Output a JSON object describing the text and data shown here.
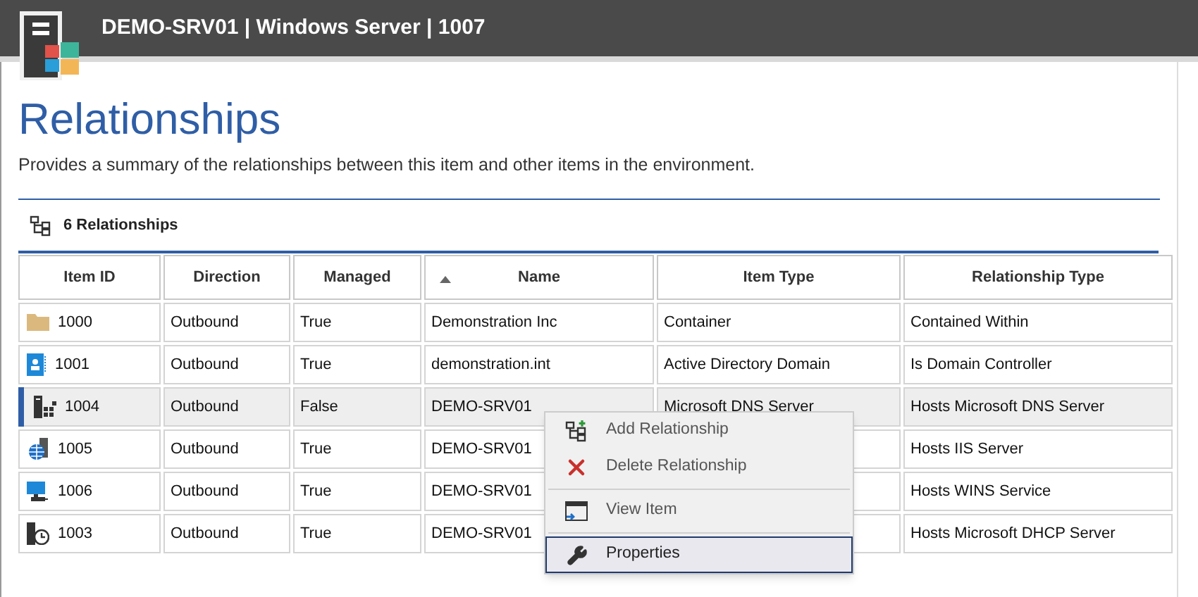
{
  "header": {
    "title": "DEMO-SRV01 | Windows Server | 1007"
  },
  "page": {
    "title": "Relationships",
    "description": "Provides a summary of the relationships between this item and other items in the environment."
  },
  "toolbar": {
    "count_label": "6 Relationships"
  },
  "table": {
    "columns": [
      {
        "label": "Item ID",
        "sorted": false
      },
      {
        "label": "Direction",
        "sorted": false
      },
      {
        "label": "Managed",
        "sorted": false
      },
      {
        "label": "Name",
        "sorted": true
      },
      {
        "label": "Item Type",
        "sorted": false
      },
      {
        "label": "Relationship Type",
        "sorted": false
      }
    ],
    "rows": [
      {
        "kind": "folder",
        "item_id": "1000",
        "direction": "Outbound",
        "managed": "True",
        "name": "Demonstration Inc",
        "item_type": "Container",
        "relationship_type": "Contained Within",
        "selected": false
      },
      {
        "kind": "domain",
        "item_id": "1001",
        "direction": "Outbound",
        "managed": "True",
        "name": "demonstration.int",
        "item_type": "Active Directory Domain",
        "relationship_type": "Is Domain Controller",
        "selected": false
      },
      {
        "kind": "dns",
        "item_id": "1004",
        "direction": "Outbound",
        "managed": "False",
        "name": "DEMO-SRV01",
        "item_type": "Microsoft DNS Server",
        "relationship_type": "Hosts Microsoft DNS Server",
        "selected": true
      },
      {
        "kind": "web",
        "item_id": "1005",
        "direction": "Outbound",
        "managed": "True",
        "name": "DEMO-SRV01",
        "relationship_type": "Hosts IIS Server",
        "selected": false
      },
      {
        "kind": "monitor",
        "item_id": "1006",
        "direction": "Outbound",
        "managed": "True",
        "name": "DEMO-SRV01",
        "relationship_type": "Hosts WINS Service",
        "selected": false
      },
      {
        "kind": "clock",
        "item_id": "1003",
        "direction": "Outbound",
        "managed": "True",
        "name": "DEMO-SRV01",
        "relationship_type": "Hosts Microsoft DHCP Server",
        "selected": false
      }
    ]
  },
  "context_menu": {
    "items": [
      {
        "kind": "add",
        "label": "Add Relationship",
        "highlighted": false
      },
      {
        "kind": "delete",
        "label": "Delete Relationship",
        "highlighted": false
      },
      {
        "kind": "separator"
      },
      {
        "kind": "view",
        "label": "View Item",
        "highlighted": false
      },
      {
        "kind": "separator"
      },
      {
        "kind": "properties",
        "label": "Properties",
        "highlighted": true
      }
    ]
  }
}
